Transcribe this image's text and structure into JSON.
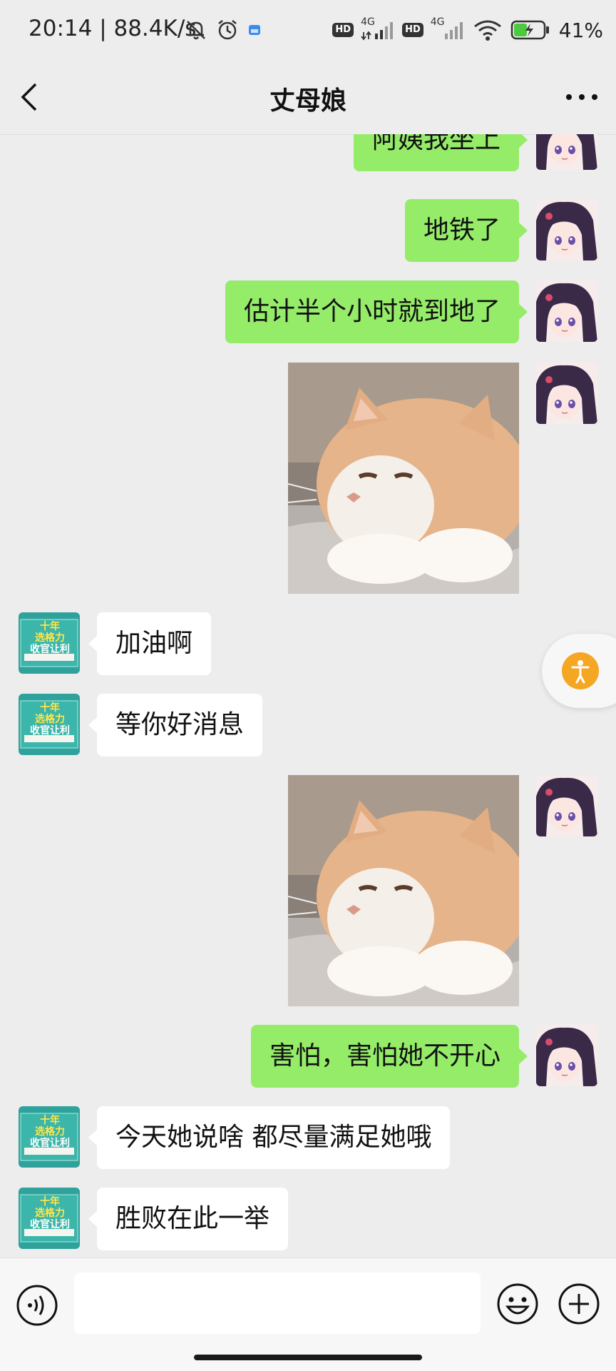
{
  "status_bar": {
    "time_speed": "20:14 | 88.4K/s",
    "net1": "4G",
    "net2": "4G",
    "hd1": "HD",
    "hd2": "HD",
    "battery": "41%"
  },
  "nav": {
    "title": "丈母娘",
    "back_icon": "chevron-left-icon",
    "more_icon": "more-dots-icon"
  },
  "messages": [
    {
      "from": "me",
      "type": "text",
      "text": "阿姨我坐上"
    },
    {
      "from": "me",
      "type": "text",
      "text": "地铁了"
    },
    {
      "from": "me",
      "type": "text",
      "text": "估计半个小时就到地了"
    },
    {
      "from": "me",
      "type": "sticker",
      "sticker": "sleepy-cat"
    },
    {
      "from": "them",
      "type": "text",
      "text": "加油啊"
    },
    {
      "from": "them",
      "type": "text",
      "text": "等你好消息"
    },
    {
      "from": "me",
      "type": "sticker",
      "sticker": "sleepy-cat"
    },
    {
      "from": "me",
      "type": "text",
      "text": "害怕，害怕她不开心"
    },
    {
      "from": "them",
      "type": "text",
      "text": "今天她说啥 都尽量满足她哦"
    },
    {
      "from": "them",
      "type": "text",
      "text": "胜败在此一举"
    }
  ],
  "them_avatar": {
    "line1": "十年",
    "line2": "选格力",
    "line3": "收官让利"
  },
  "input": {
    "value": "",
    "voice_icon": "voice-icon",
    "emoji_icon": "emoji-icon",
    "plus_icon": "plus-icon"
  },
  "colors": {
    "background": "#ededed",
    "my_bubble": "#95ec69",
    "their_bubble": "#ffffff",
    "float_button": "#f5a623"
  }
}
